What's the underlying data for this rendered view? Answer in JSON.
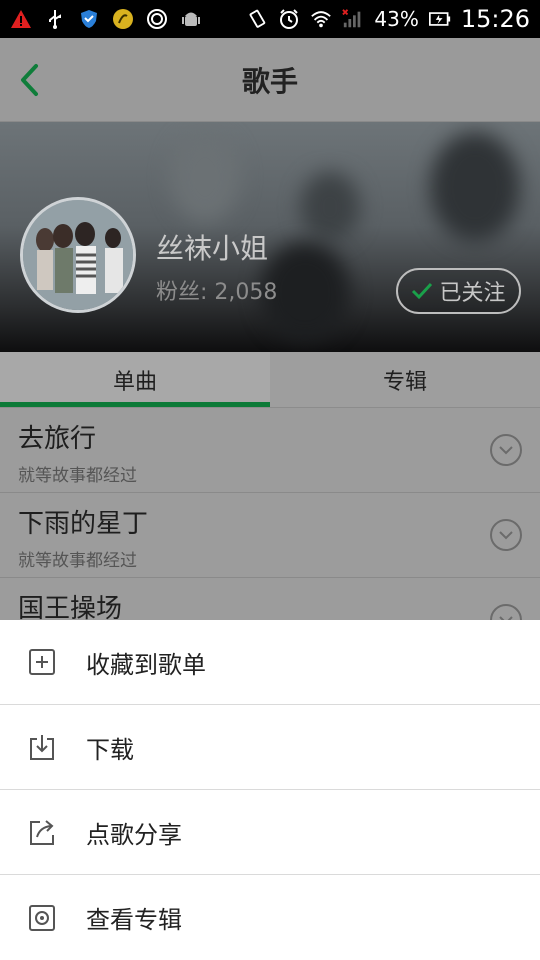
{
  "status_bar": {
    "battery": "43%",
    "time": "15:26",
    "icons": [
      "warning-icon",
      "usb-icon",
      "shield-icon",
      "coin-icon",
      "ring-icon",
      "android-icon",
      "vibrate-icon",
      "alarm-icon",
      "wifi-icon",
      "signal-icon",
      "battery-icon"
    ]
  },
  "header": {
    "title": "歌手",
    "back_icon": "chevron-left-icon"
  },
  "artist": {
    "name": "丝袜小姐",
    "fans": "粉丝: 2,058",
    "follow_label": "已关注"
  },
  "tabs": [
    {
      "label": "单曲",
      "active": true
    },
    {
      "label": "专辑",
      "active": false
    }
  ],
  "songs": [
    {
      "title": "去旅行",
      "subtitle": "就等故事都经过"
    },
    {
      "title": "下雨的星丁",
      "subtitle": "就等故事都经过"
    },
    {
      "title": "国王操场",
      "subtitle": ""
    }
  ],
  "sheet": {
    "items": [
      {
        "label": "收藏到歌单",
        "icon": "add-to-playlist-icon"
      },
      {
        "label": "下载",
        "icon": "download-icon"
      },
      {
        "label": "点歌分享",
        "icon": "share-icon"
      },
      {
        "label": "查看专辑",
        "icon": "album-icon"
      }
    ]
  },
  "colors": {
    "accent": "#1a9e4a",
    "statusbar": "#000000",
    "overlay_header": "#9a9a9a"
  }
}
